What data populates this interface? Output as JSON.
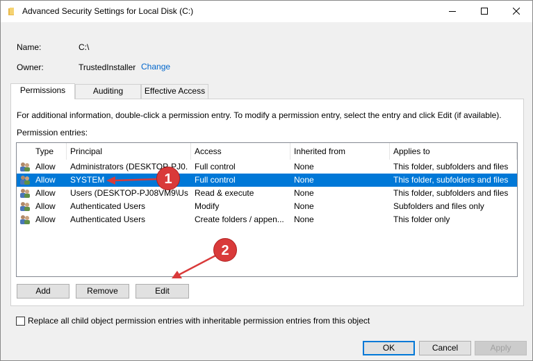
{
  "window": {
    "title": "Advanced Security Settings for Local Disk (C:)"
  },
  "info": {
    "name_label": "Name:",
    "name_value": "C:\\",
    "owner_label": "Owner:",
    "owner_value": "TrustedInstaller",
    "change_link": "Change"
  },
  "tabs": [
    {
      "label": "Permissions",
      "active": true
    },
    {
      "label": "Auditing",
      "active": false
    },
    {
      "label": "Effective Access",
      "active": false
    }
  ],
  "panel": {
    "instruction": "For additional information, double-click a permission entry. To modify a permission entry, select the entry and click Edit (if available).",
    "entries_label": "Permission entries:"
  },
  "grid": {
    "columns": [
      "Type",
      "Principal",
      "Access",
      "Inherited from",
      "Applies to"
    ],
    "rows": [
      {
        "type": "Allow",
        "principal": "Administrators (DESKTOP-PJ0...",
        "access": "Full control",
        "inherited": "None",
        "applies": "This folder, subfolders and files",
        "selected": false
      },
      {
        "type": "Allow",
        "principal": "SYSTEM",
        "access": "Full control",
        "inherited": "None",
        "applies": "This folder, subfolders and files",
        "selected": true
      },
      {
        "type": "Allow",
        "principal": "Users (DESKTOP-PJ08VM9\\Use...",
        "access": "Read & execute",
        "inherited": "None",
        "applies": "This folder, subfolders and files",
        "selected": false
      },
      {
        "type": "Allow",
        "principal": "Authenticated Users",
        "access": "Modify",
        "inherited": "None",
        "applies": "Subfolders and files only",
        "selected": false
      },
      {
        "type": "Allow",
        "principal": "Authenticated Users",
        "access": "Create folders / appen...",
        "inherited": "None",
        "applies": "This folder only",
        "selected": false
      }
    ]
  },
  "buttons": {
    "add": "Add",
    "remove": "Remove",
    "edit": "Edit",
    "ok": "OK",
    "cancel": "Cancel",
    "apply": "Apply"
  },
  "replace_checkbox": {
    "label": "Replace all child object permission entries with inheritable permission entries from this object",
    "checked": false
  },
  "annotations": {
    "badge1": "1",
    "badge2": "2",
    "color": "#d93a3a"
  },
  "icons": {
    "title": "folder-icon",
    "user": "users-icon"
  }
}
